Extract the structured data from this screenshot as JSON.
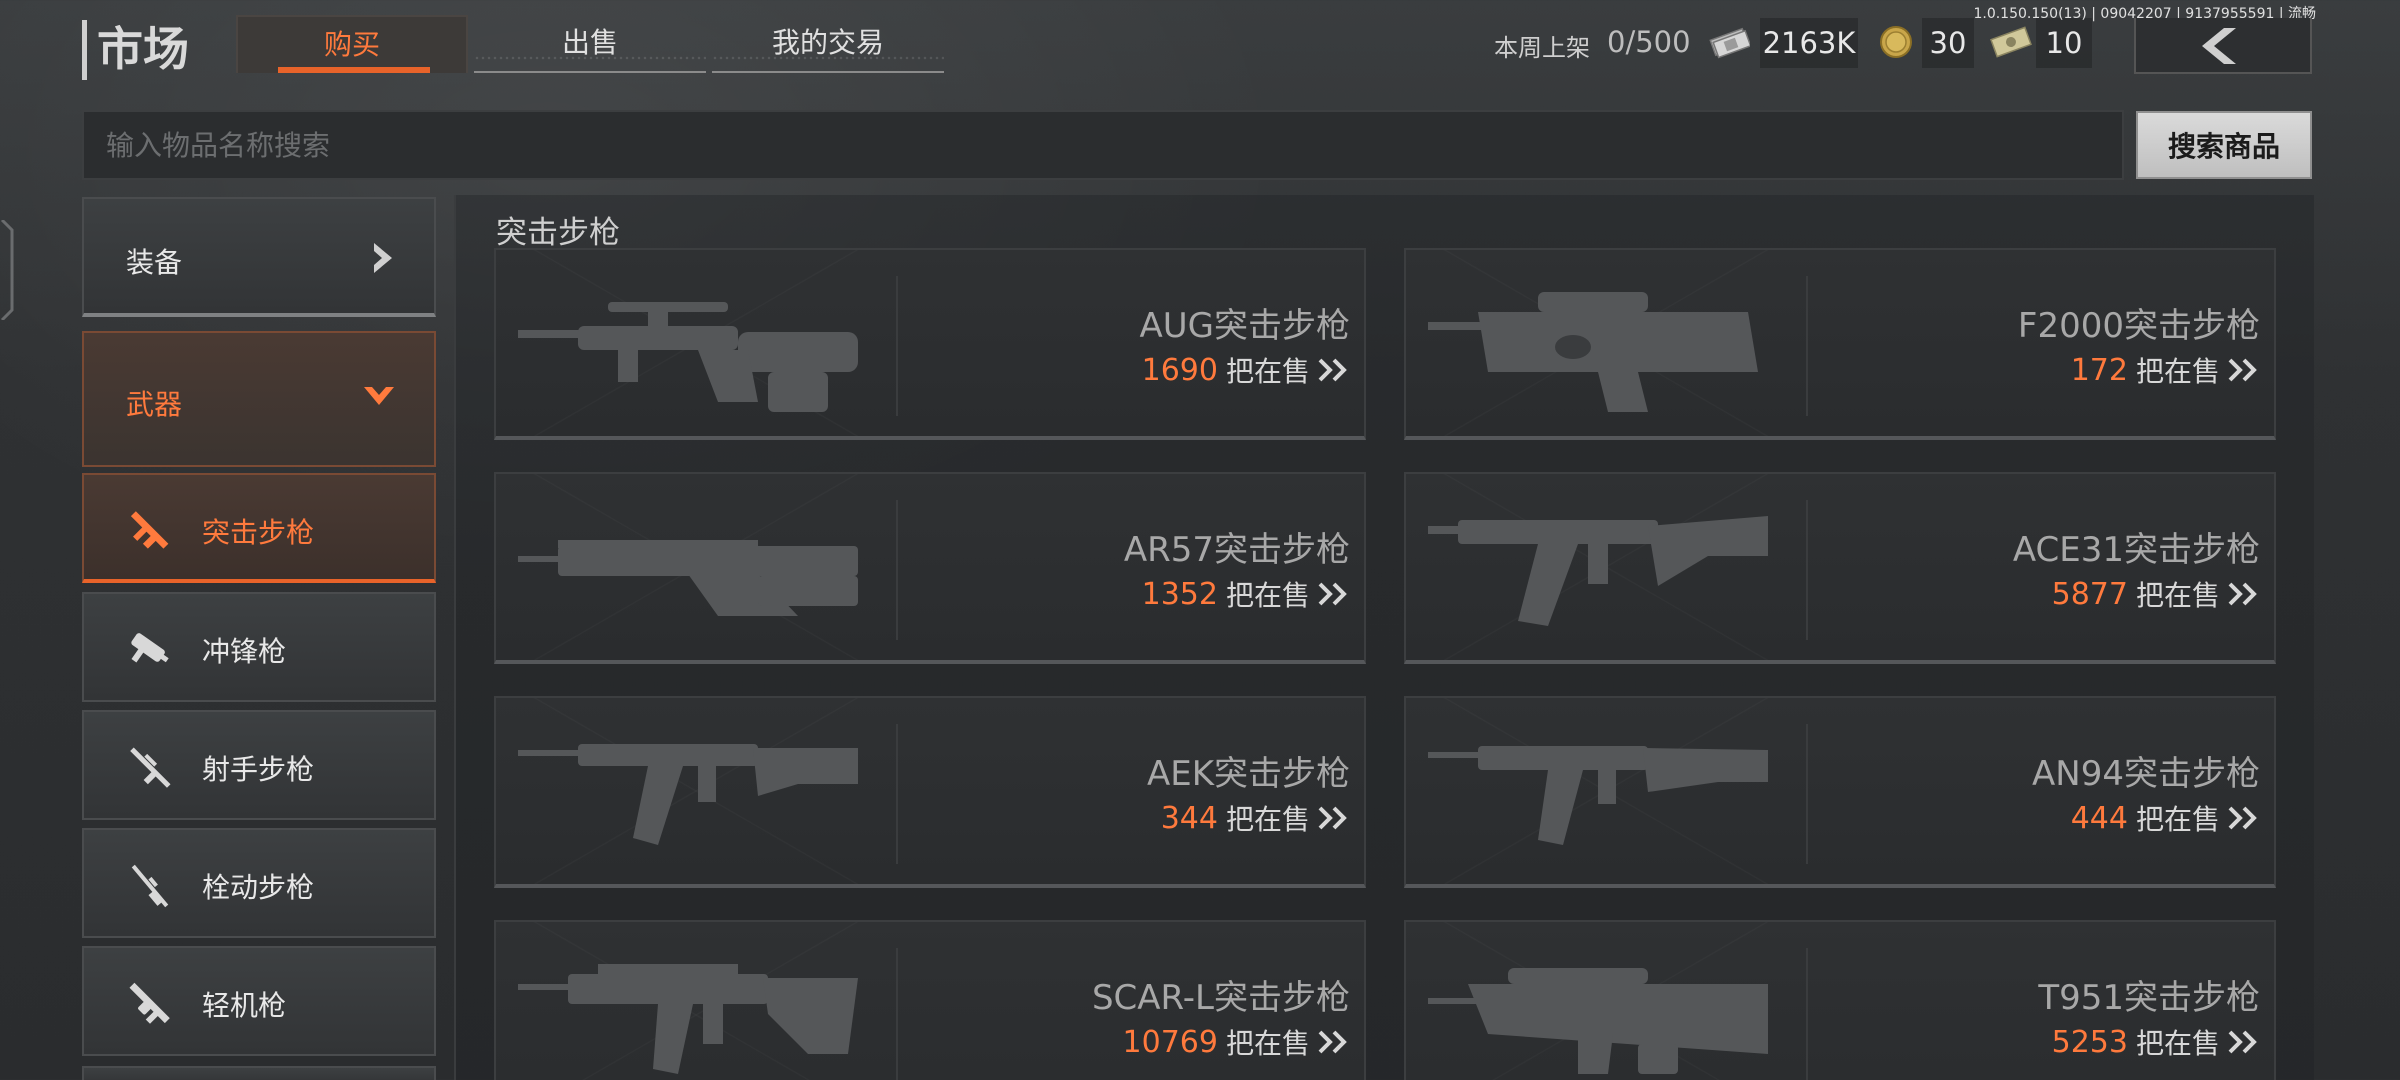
{
  "header": {
    "title": "市场",
    "tabs": [
      {
        "label": "购买",
        "active": true
      },
      {
        "label": "出售",
        "active": false
      },
      {
        "label": "我的交易",
        "active": false
      }
    ],
    "weekly_label": "本周上架",
    "weekly_value": "0/500",
    "currencies": [
      {
        "icon": "cash-stack-icon",
        "value": "2163K"
      },
      {
        "icon": "gold-coin-icon",
        "value": "30"
      },
      {
        "icon": "ticket-bill-icon",
        "value": "10"
      }
    ],
    "version": "1.0.150.150(13) | 09042207 | 9137955591 | 流畅"
  },
  "search": {
    "placeholder": "输入物品名称搜索",
    "value": "",
    "button_label": "搜索商品"
  },
  "sidebar": {
    "categories": [
      {
        "label": "装备",
        "expanded": false
      },
      {
        "label": "武器",
        "expanded": true
      }
    ],
    "subcategories": [
      {
        "label": "突击步枪",
        "active": true,
        "icon": "assault-rifle-icon"
      },
      {
        "label": "冲锋枪",
        "active": false,
        "icon": "smg-icon"
      },
      {
        "label": "射手步枪",
        "active": false,
        "icon": "marksman-rifle-icon"
      },
      {
        "label": "栓动步枪",
        "active": false,
        "icon": "bolt-rifle-icon"
      },
      {
        "label": "轻机枪",
        "active": false,
        "icon": "lmg-icon"
      }
    ]
  },
  "main": {
    "section_title": "突击步枪",
    "sale_suffix": "把在售",
    "items": [
      {
        "name": "AUG突击步枪",
        "count": "1690"
      },
      {
        "name": "F2000突击步枪",
        "count": "172"
      },
      {
        "name": "AR57突击步枪",
        "count": "1352"
      },
      {
        "name": "ACE31突击步枪",
        "count": "5877"
      },
      {
        "name": "AEK突击步枪",
        "count": "344"
      },
      {
        "name": "AN94突击步枪",
        "count": "444"
      },
      {
        "name": "SCAR-L突击步枪",
        "count": "10769"
      },
      {
        "name": "T951突击步枪",
        "count": "5253"
      }
    ]
  },
  "colors": {
    "accent": "#e8632a",
    "accent_text": "#ff7a3d",
    "background": "#2f3133"
  }
}
